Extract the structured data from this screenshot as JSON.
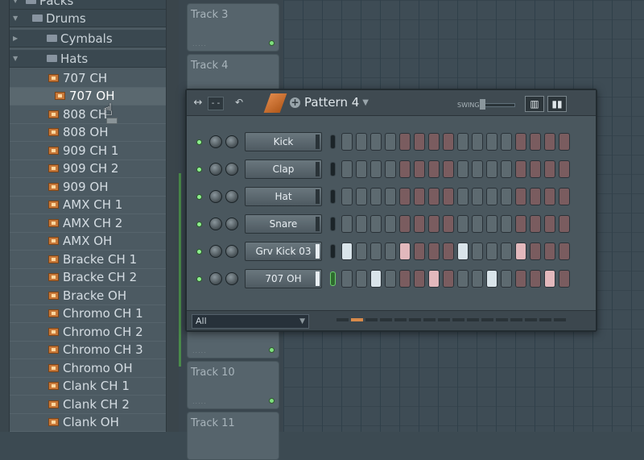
{
  "browser": {
    "folders": [
      {
        "label": "Packs"
      },
      {
        "label": "Drums"
      },
      {
        "label": "Cymbals"
      },
      {
        "label": "Hats"
      }
    ],
    "files": [
      {
        "label": "707 CH"
      },
      {
        "label": "707 OH"
      },
      {
        "label": "808 CH"
      },
      {
        "label": "808 OH"
      },
      {
        "label": "909 CH 1"
      },
      {
        "label": "909 CH 2"
      },
      {
        "label": "909 OH"
      },
      {
        "label": "AMX CH 1"
      },
      {
        "label": "AMX CH 2"
      },
      {
        "label": "AMX OH"
      },
      {
        "label": "Bracke CH 1"
      },
      {
        "label": "Bracke CH 2"
      },
      {
        "label": "Bracke OH"
      },
      {
        "label": "Chromo CH 1"
      },
      {
        "label": "Chromo CH 2"
      },
      {
        "label": "Chromo CH 3"
      },
      {
        "label": "Chromo OH"
      },
      {
        "label": "Clank CH 1"
      },
      {
        "label": "Clank CH 2"
      },
      {
        "label": "Clank OH"
      }
    ]
  },
  "tracks": [
    {
      "label": "Track 3"
    },
    {
      "label": "Track 4"
    },
    {
      "label": "Track 10"
    },
    {
      "label": "Track 11"
    }
  ],
  "rack": {
    "pattern_label": "Pattern 4",
    "swing_label": "SWING",
    "filter_value": "All",
    "channels": [
      {
        "name": "Kick"
      },
      {
        "name": "Clap"
      },
      {
        "name": "Hat"
      },
      {
        "name": "Snare"
      },
      {
        "name": "Grv Kick 03"
      },
      {
        "name": "707 OH"
      }
    ]
  },
  "colors": {
    "accent": "#d88a4a",
    "led": "#8ef08e"
  }
}
